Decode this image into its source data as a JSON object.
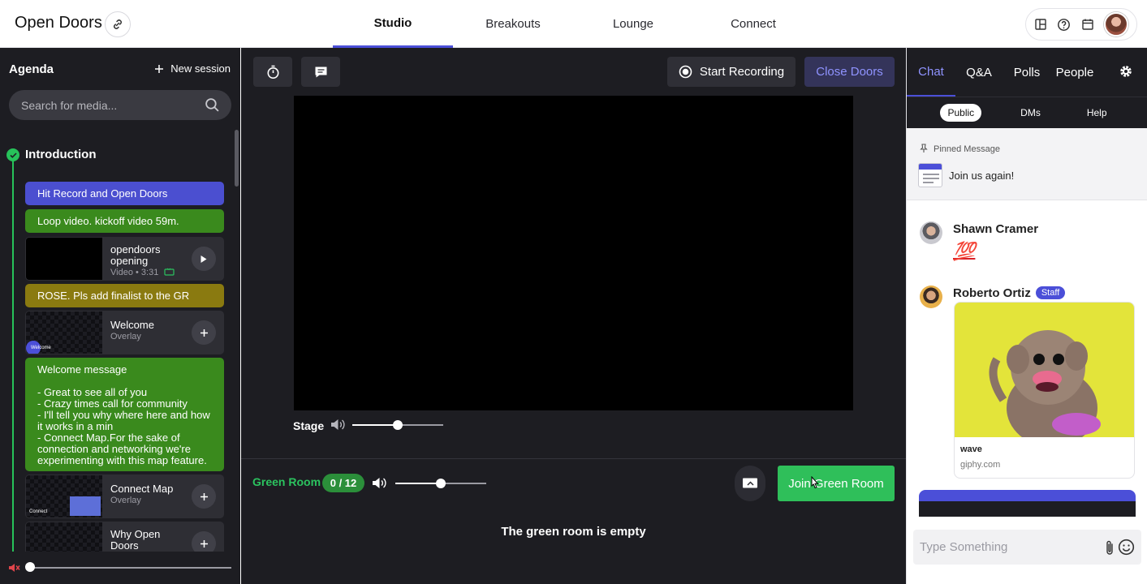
{
  "app": {
    "title": "Open Doors",
    "tabs": [
      {
        "label": "Studio",
        "active": true
      },
      {
        "label": "Breakouts",
        "active": false
      },
      {
        "label": "Lounge",
        "active": false
      },
      {
        "label": "Connect",
        "active": false
      }
    ],
    "top_icons": [
      "layout-icon",
      "help-icon",
      "calendar-icon"
    ]
  },
  "sidebar": {
    "title": "Agenda",
    "new_session_label": "New session",
    "search_placeholder": "Search for media...",
    "section_title": "Introduction",
    "items": [
      {
        "kind": "note",
        "color": "purple",
        "text": "Hit Record and Open Doors"
      },
      {
        "kind": "note",
        "color": "green",
        "text": "Loop video. kickoff video 59m."
      },
      {
        "kind": "media",
        "name": "opendoors opening",
        "sub": "Video • 3:31",
        "action": "play"
      },
      {
        "kind": "note",
        "color": "gold",
        "text": "ROSE. Pls add finalist to the GR"
      },
      {
        "kind": "media",
        "name": "Welcome",
        "sub": "Overlay",
        "thumb_text": "Welcome",
        "action": "add"
      },
      {
        "kind": "note",
        "color": "green",
        "text": "Welcome message\n\n- Great to see all of you\n- Crazy times call for community\n- I'll tell you why where here and how it works in a min\n-  Connect Map.For the sake of connection and networking we're experimenting with this map feature."
      },
      {
        "kind": "media",
        "name": "Connect Map",
        "sub": "Overlay",
        "thumb_text": "Connect",
        "action": "add"
      },
      {
        "kind": "media",
        "name": "Why Open Doors",
        "sub": "",
        "action": "add"
      }
    ],
    "volume": 0.0
  },
  "center": {
    "record_label": "Start Recording",
    "close_doors_label": "Close Doors",
    "stage_label": "Stage",
    "stage_volume": 0.5,
    "green_room_label": "Green Room",
    "green_room_count": "0 / 12",
    "green_room_volume": 0.5,
    "join_label": "Join Green Room",
    "green_room_empty": "The green room is empty"
  },
  "chat": {
    "tabs": [
      {
        "label": "Chat",
        "active": true
      },
      {
        "label": "Q&A",
        "active": false
      },
      {
        "label": "Polls",
        "active": false
      },
      {
        "label": "People",
        "active": false
      }
    ],
    "subtabs": [
      {
        "label": "Public",
        "active": true
      },
      {
        "label": "DMs",
        "active": false
      },
      {
        "label": "Help",
        "active": false
      }
    ],
    "pinned_label": "Pinned Message",
    "pinned_text": "Join us again!",
    "messages": [
      {
        "author": "Shawn Cramer",
        "content": "💯"
      },
      {
        "author": "Roberto Ortiz",
        "badge": "Staff",
        "giphy_title": "wave",
        "giphy_source": "giphy.com"
      }
    ],
    "input_placeholder": "Type Something"
  },
  "colors": {
    "accent": "#4b4fd8",
    "green": "#2fbf5a",
    "dark": "#1d1d22"
  }
}
